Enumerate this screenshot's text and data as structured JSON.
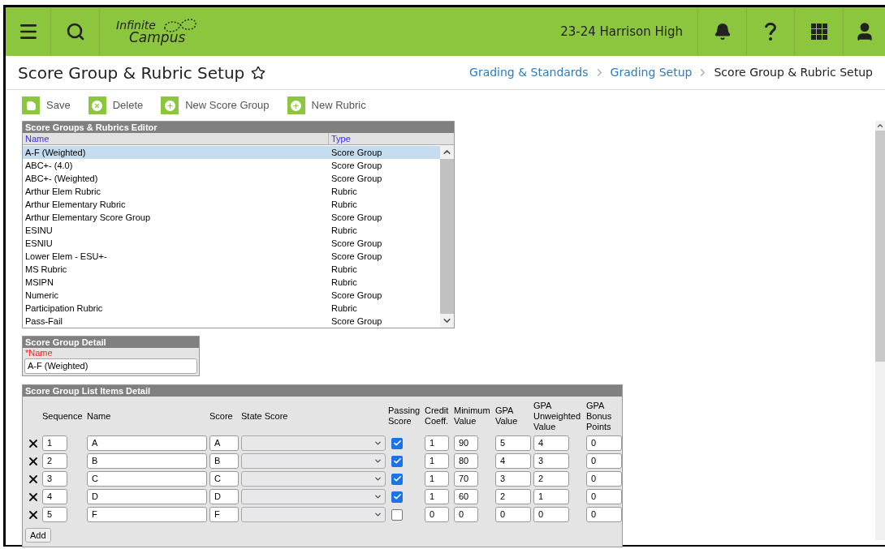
{
  "header": {
    "logo": {
      "line1": "Infinite",
      "line2": "Campus"
    },
    "school": "23-24 Harrison High"
  },
  "page": {
    "title": "Score Group & Rubric Setup"
  },
  "breadcrumbs": [
    {
      "label": "Grading & Standards",
      "kind": "link"
    },
    {
      "label": "Grading Setup",
      "kind": "link"
    },
    {
      "label": "Score Group & Rubric Setup",
      "kind": "current"
    }
  ],
  "toolbar": [
    {
      "label": "Save",
      "kind": "save"
    },
    {
      "label": "Delete",
      "kind": "delete"
    },
    {
      "label": "New Score Group",
      "kind": "add"
    },
    {
      "label": "New Rubric",
      "kind": "add"
    }
  ],
  "editor": {
    "title": "Score Groups & Rubrics Editor",
    "columns": [
      "Name",
      "Type"
    ],
    "rows": [
      {
        "name": "A-F (Weighted)",
        "type": "Score Group",
        "selected": true
      },
      {
        "name": "ABC+- (4.0)",
        "type": "Score Group",
        "selected": false
      },
      {
        "name": "ABC+- (Weighted)",
        "type": "Score Group",
        "selected": false
      },
      {
        "name": "Arthur Elem Rubric",
        "type": "Rubric",
        "selected": false
      },
      {
        "name": "Arthur Elementary Rubric",
        "type": "Rubric",
        "selected": false
      },
      {
        "name": "Arthur Elementary Score Group",
        "type": "Score Group",
        "selected": false
      },
      {
        "name": "ESINU",
        "type": "Rubric",
        "selected": false
      },
      {
        "name": "ESNIU",
        "type": "Score Group",
        "selected": false
      },
      {
        "name": "Lower Elem - ESU+-",
        "type": "Score Group",
        "selected": false
      },
      {
        "name": "MS Rubric",
        "type": "Rubric",
        "selected": false
      },
      {
        "name": "MSIPN",
        "type": "Rubric",
        "selected": false
      },
      {
        "name": "Numeric",
        "type": "Score Group",
        "selected": false
      },
      {
        "name": "Participation Rubric",
        "type": "Rubric",
        "selected": false
      },
      {
        "name": "Pass-Fail",
        "type": "Score Group",
        "selected": false
      }
    ]
  },
  "detail": {
    "title": "Score Group Detail",
    "label": "*Name",
    "value": "A-F (Weighted)"
  },
  "items": {
    "title": "Score Group List Items Detail",
    "columns": [
      "Sequence",
      "Name",
      "Score",
      "State Score",
      "Passing Score",
      "Credit Coeff.",
      "Minimum Value",
      "GPA Value",
      "GPA Unweighted Value",
      "GPA Bonus Points"
    ],
    "rows": [
      {
        "sequence": "1",
        "name": "A",
        "score": "A",
        "passing": true,
        "credit": "1",
        "minimum": "90",
        "gpa": "5",
        "unweighted": "4",
        "bonus": "0"
      },
      {
        "sequence": "2",
        "name": "B",
        "score": "B",
        "passing": true,
        "credit": "1",
        "minimum": "80",
        "gpa": "4",
        "unweighted": "3",
        "bonus": "0"
      },
      {
        "sequence": "3",
        "name": "C",
        "score": "C",
        "passing": true,
        "credit": "1",
        "minimum": "70",
        "gpa": "3",
        "unweighted": "2",
        "bonus": "0"
      },
      {
        "sequence": "4",
        "name": "D",
        "score": "D",
        "passing": true,
        "credit": "1",
        "minimum": "60",
        "gpa": "2",
        "unweighted": "1",
        "bonus": "0"
      },
      {
        "sequence": "5",
        "name": "F",
        "score": "F",
        "passing": false,
        "credit": "0",
        "minimum": "0",
        "gpa": "0",
        "unweighted": "0",
        "bonus": "0"
      }
    ],
    "add_button": "Add"
  }
}
